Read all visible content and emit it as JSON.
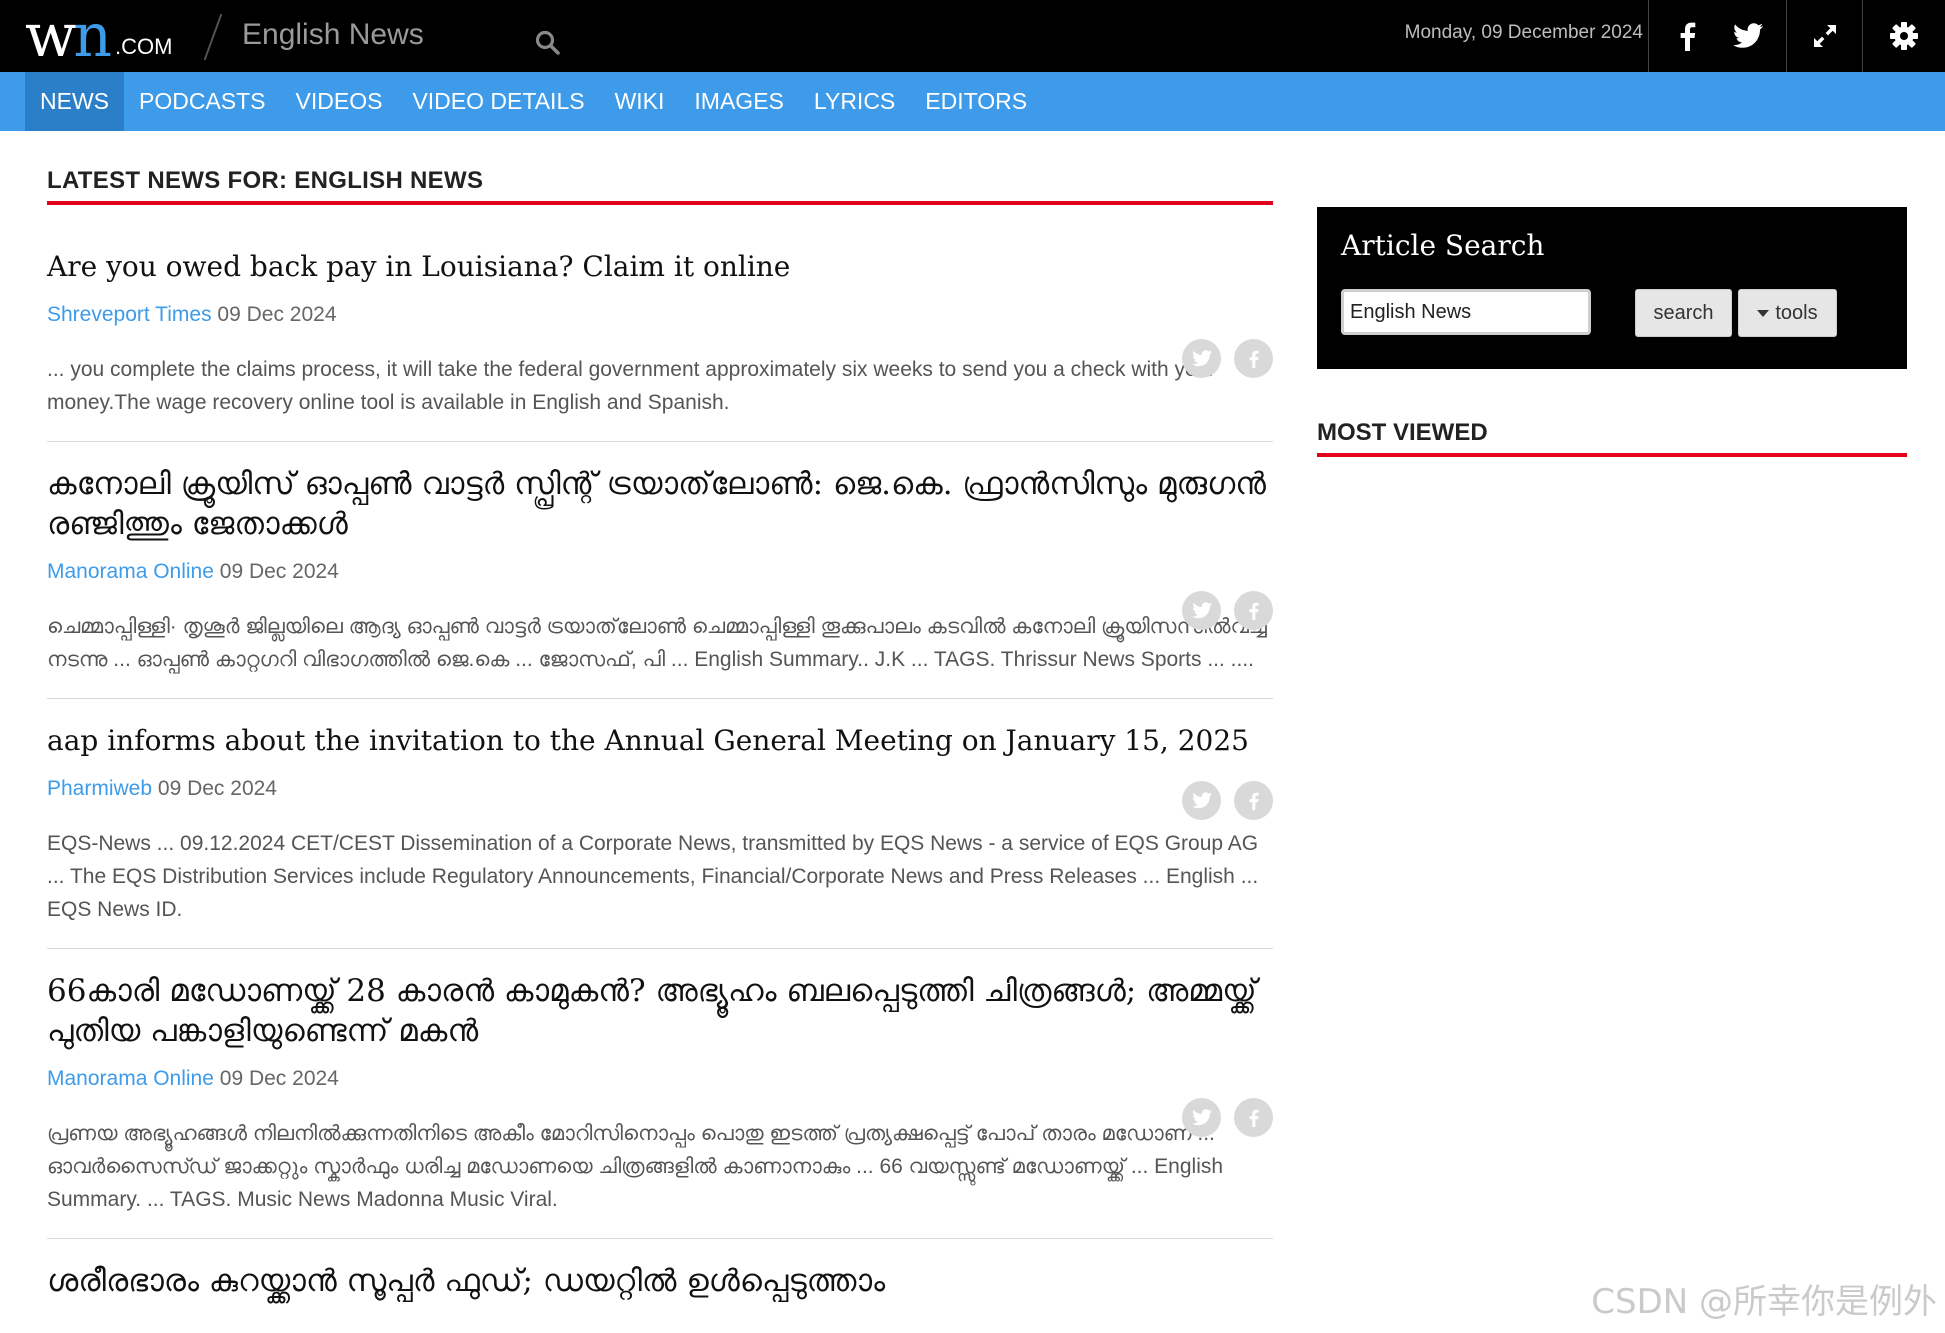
{
  "header": {
    "logo_text": "wn",
    "logo_suffix": ".COM",
    "site_title": "English News",
    "date": "Monday, 09 December 2024",
    "icons": [
      "search-icon",
      "facebook-icon",
      "twitter-icon",
      "fullscreen-icon",
      "gear-icon"
    ]
  },
  "nav": {
    "items": [
      {
        "label": "NEWS",
        "active": true
      },
      {
        "label": "PODCASTS",
        "active": false
      },
      {
        "label": "VIDEOS",
        "active": false
      },
      {
        "label": "VIDEO DETAILS",
        "active": false
      },
      {
        "label": "WIKI",
        "active": false
      },
      {
        "label": "IMAGES",
        "active": false
      },
      {
        "label": "LYRICS",
        "active": false
      },
      {
        "label": "EDITORS",
        "active": false
      }
    ]
  },
  "main": {
    "section_title": "LATEST NEWS FOR: ENGLISH NEWS",
    "articles": [
      {
        "title": "Are you owed back pay in Louisiana? Claim it online",
        "source": "Shreveport Times",
        "date": "09 Dec 2024",
        "summary": "... you complete the claims process, it will take the federal government approximately six weeks to send you a check with your money.The wage recovery online tool is available in English and Spanish."
      },
      {
        "title": "കനോലി ക്രൂയിസ് ഓപ്പൺ വാട്ടർ സ്പ്രിന്റ് ട്രയാത്‌ലോൺ: ജെ.കെ. ഫ്രാൻസിസും മുരുഗൻ രഞ്ജിത്തും ജേതാക്കൾ",
        "source": "Manorama Online",
        "date": "09 Dec 2024",
        "summary": "ചെമ്മാപ്പിള്ളി· തൃശൂർ ജില്ലയിലെ ആദ്യ ഓപ്പൺ വാട്ടർ ട്രയാത്‌ലോൺ ചെമ്മാപ്പിള്ളി തൂക്കുപാലം കടവിൽ കനോലി ക്രൂയിസസിൽവച്ച് നടന്നു ... ഓപ്പൺ കാറ്റഗറി വിഭാഗത്തിൽ ജെ.കെ ... ജോസഫ്, പി ... English Summary.. J.K ... TAGS. Thrissur News Sports ... ...."
      },
      {
        "title": "aap informs about the invitation to the Annual General Meeting on January 15, 2025",
        "source": "Pharmiweb",
        "date": "09 Dec 2024",
        "summary": "EQS-News ... 09.12.2024 CET/CEST Dissemination of a Corporate News, transmitted by EQS News - a service of EQS Group AG ... The EQS Distribution Services include Regulatory Announcements, Financial/Corporate News and Press Releases ... English ... EQS News ID."
      },
      {
        "title": "66കാരി മഡോണയ്ക്ക് 28 കാരൻ കാമുകൻ? അഭ്യൂഹം ബലപ്പെടുത്തി ചിത്രങ്ങൾ; അമ്മയ്ക്ക് പുതിയ പങ്കാളിയുണ്ടെന്ന് മകൻ",
        "source": "Manorama Online",
        "date": "09 Dec 2024",
        "summary": "പ്രണയ അഭ്യൂഹങ്ങൾ നിലനിൽക്കുന്നതിനിടെ അകീം മോറിസിനൊപ്പം പൊതു ഇടത്ത് പ്രത്യക്ഷപ്പെട്ട് പോപ് താരം മഡോണ ... ഓവർസൈസ്ഡ് ജാക്കറ്റും സ്കാർഫും ധരിച്ച മഡോണയെ ചിത്രങ്ങളിൽ കാണാനാകും ... 66 വയസ്സുണ്ട് മഡോണയ്ക്ക് ... English Summary. ... TAGS. Music News Madonna Music Viral."
      },
      {
        "title": "ശരീരഭാരം കുറയ്ക്കാൻ സൂപ്പർ ഫുഡ്; ഡയറ്റിൽ ഉൾപ്പെടുത്താം",
        "source": "",
        "date": "",
        "summary": ""
      }
    ]
  },
  "sidebar": {
    "search_title": "Article Search",
    "search_value": "English News",
    "search_button": "search",
    "tools_button": "tools",
    "most_viewed": "MOST VIEWED"
  },
  "watermark": "CSDN @所幸你是例外"
}
